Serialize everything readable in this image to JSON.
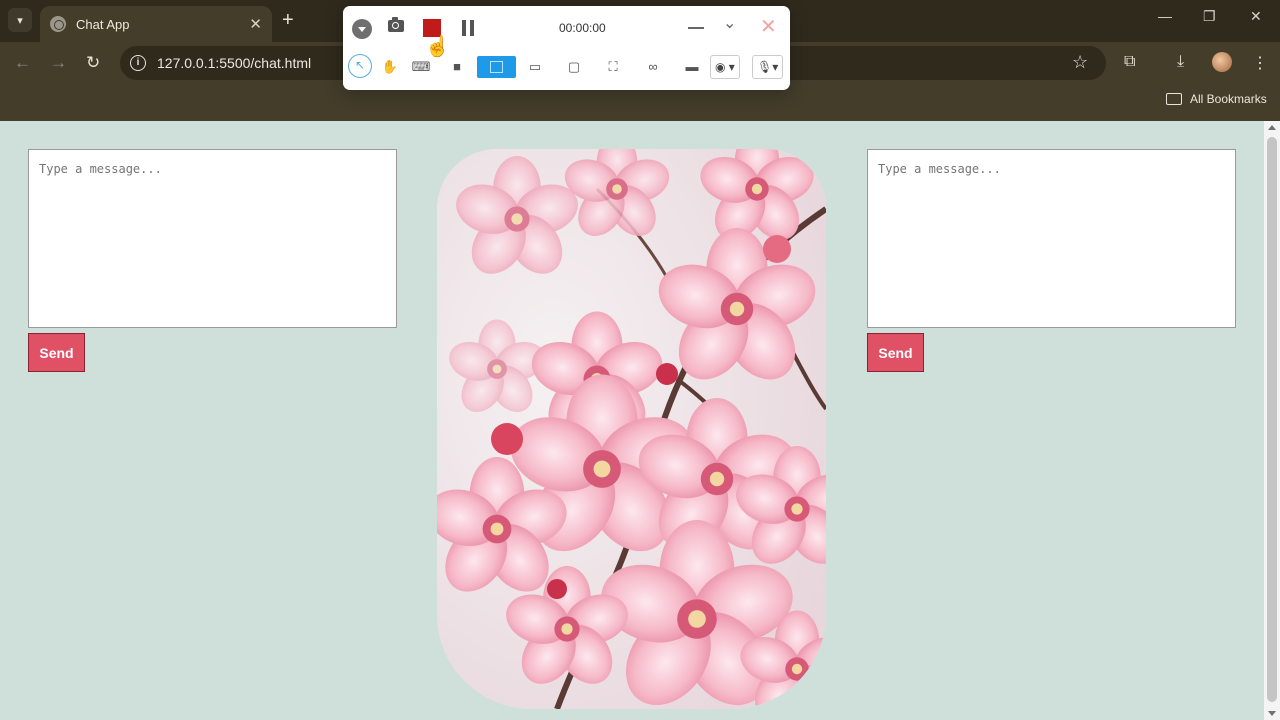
{
  "browser": {
    "tab_title": "Chat App",
    "tab_close": "✕",
    "new_tab": "+",
    "url": "127.0.0.1:5500/chat.html",
    "bookmarks_label": "All Bookmarks",
    "window_controls": {
      "minimize": "—",
      "restore": "❐",
      "close": "✕"
    }
  },
  "recorder": {
    "timer": "00:00:00"
  },
  "chat": {
    "left": {
      "placeholder": "Type a message...",
      "send_label": "Send"
    },
    "right": {
      "placeholder": "Type a message...",
      "send_label": "Send"
    }
  },
  "image": {
    "subject": "pink-cherry-blossoms"
  },
  "colors": {
    "page_background": "#cfe0db",
    "send_button": "#e05166",
    "recorder_stop": "#c01a1a",
    "recorder_active_tool": "#1e9be8"
  }
}
